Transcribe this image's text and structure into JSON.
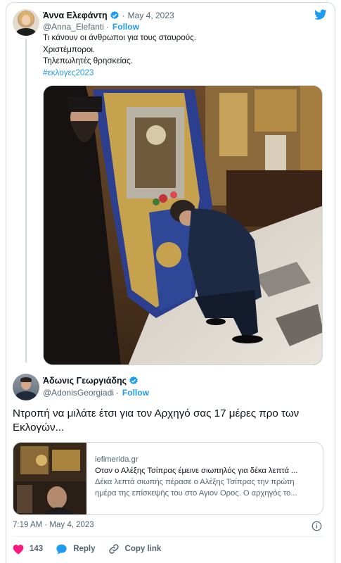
{
  "quoted": {
    "display_name": "Άννα Ελεφάντη",
    "date": "May 4, 2023",
    "handle": "@Anna_Elefanti",
    "follow_label": "Follow",
    "lines": [
      "Τι κάνουν οι άνθρωποι για τους σταυρούς.",
      "Χριστέμποροι.",
      "Τηλεπωλητές θρησκείας."
    ],
    "hashtag": "#εκλογες2023"
  },
  "main": {
    "display_name": "Άδωνις Γεωργιάδης",
    "handle": "@AdonisGeorgiadi",
    "follow_label": "Follow",
    "text": "Ντροπή να μιλάτε έτσι για τον Αρχηγό σας 17 μέρες προ των Εκλογών...",
    "card": {
      "domain": "iefimerida.gr",
      "title": "Οταν ο Αλέξης Τσίπρας έμεινε σιωπηλός για δέκα λεπτά ...",
      "description": "Δέκα λεπτά σιωπής πέρασε ο Αλέξης Τσίπρας την πρώτη ημέρα της επίσκεψής του στο Αγιον Ορος. Ο αρχηγός το..."
    },
    "timestamp": "7:19 AM · May 4, 2023",
    "likes": "143",
    "reply_label": "Reply",
    "copy_label": "Copy link"
  },
  "colors": {
    "accent": "#1d9bf0",
    "like": "#f91880",
    "muted": "#536471"
  }
}
